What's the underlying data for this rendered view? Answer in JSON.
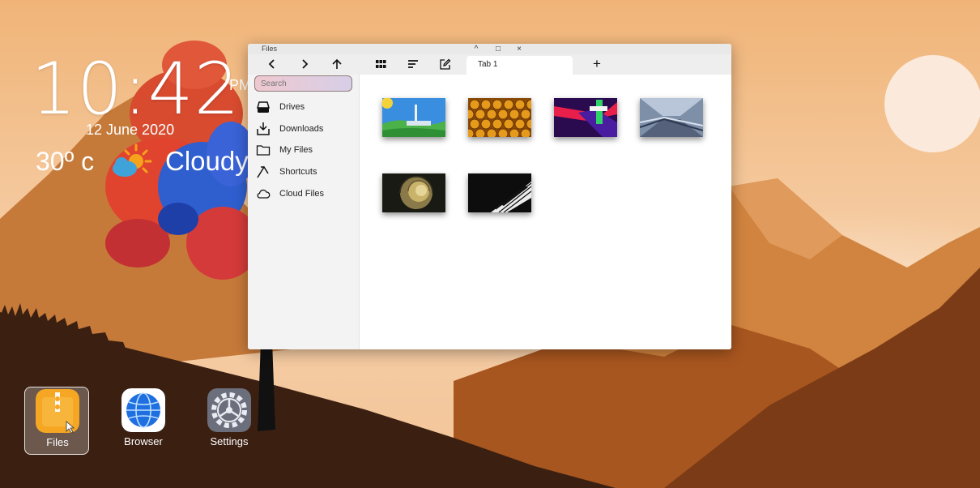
{
  "clock": {
    "time": "10:42",
    "ampm": "PM",
    "date": "12 June 2020"
  },
  "weather": {
    "temperature": "30º c",
    "condition": "Cloudy",
    "icon": "partly-cloudy-icon"
  },
  "window": {
    "title": "Files",
    "controls": {
      "minimize": "^",
      "maximize": "□",
      "close": "×"
    },
    "toolbar": {
      "buttons": [
        "back-icon",
        "forward-icon",
        "up-icon",
        "grid-view-icon",
        "sort-icon",
        "edit-icon"
      ],
      "tab_label": "Tab 1",
      "new_tab": "+"
    },
    "sidebar": {
      "search_placeholder": "Search",
      "items": [
        {
          "label": "Drives",
          "icon": "drive-icon"
        },
        {
          "label": "Downloads",
          "icon": "download-icon"
        },
        {
          "label": "My Files",
          "icon": "folder-icon"
        },
        {
          "label": "Shortcuts",
          "icon": "shortcut-icon"
        },
        {
          "label": "Cloud Files",
          "icon": "cloud-icon"
        }
      ]
    },
    "files": [
      {
        "name": "landscape-image"
      },
      {
        "name": "honeycomb-image"
      },
      {
        "name": "abstract-image"
      },
      {
        "name": "subway-image"
      },
      {
        "name": "nautilus-image"
      },
      {
        "name": "piano-image"
      }
    ]
  },
  "dock": [
    {
      "label": "Files",
      "icon": "files-app-icon",
      "active": true
    },
    {
      "label": "Browser",
      "icon": "browser-app-icon",
      "active": false
    },
    {
      "label": "Settings",
      "icon": "settings-app-icon",
      "active": false
    }
  ],
  "colors": {
    "sky": "#f3c08a",
    "sun": "#fbe9dc",
    "mountain": "#c76a2a",
    "hill": "#3b2012"
  }
}
